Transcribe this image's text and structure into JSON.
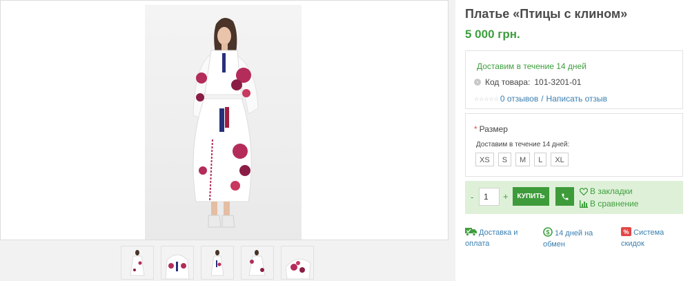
{
  "product": {
    "title": "Платье «Птицы с клином»",
    "price": "5 000 грн."
  },
  "info": {
    "delivery_text": "Доставим в течение 14 дней",
    "code_label": "Код товара:",
    "code_value": "101-3201-01",
    "code_icon": "chevron-right-circle-icon",
    "rating_stars": "☆☆☆☆☆",
    "reviews_link": "0 отзывов",
    "separator": "/",
    "write_review_link": "Написать отзыв"
  },
  "options": {
    "required_mark": "*",
    "size_label": "Размер",
    "size_note": "Доставим в течение 14 дней:",
    "sizes": [
      "XS",
      "S",
      "M",
      "L",
      "XL"
    ]
  },
  "purchase": {
    "minus": "-",
    "quantity": "1",
    "plus": "+",
    "buy_label": "КУПИТЬ",
    "bookmark_label": "В закладки",
    "compare_label": "В сравнение"
  },
  "features": {
    "delivery_line1": "Доставка и",
    "delivery_line2": "оплата",
    "exchange_line1": "14 дней на",
    "exchange_line2": "обмен",
    "discount_line1": "Система",
    "discount_line2": "скидок"
  },
  "colors": {
    "accent_green": "#3e9e3e",
    "link_blue": "#3a7fb0",
    "buy_bar_bg": "#def1d8",
    "required_red": "#e34646"
  },
  "gallery": {
    "thumbnail_count": 5
  }
}
